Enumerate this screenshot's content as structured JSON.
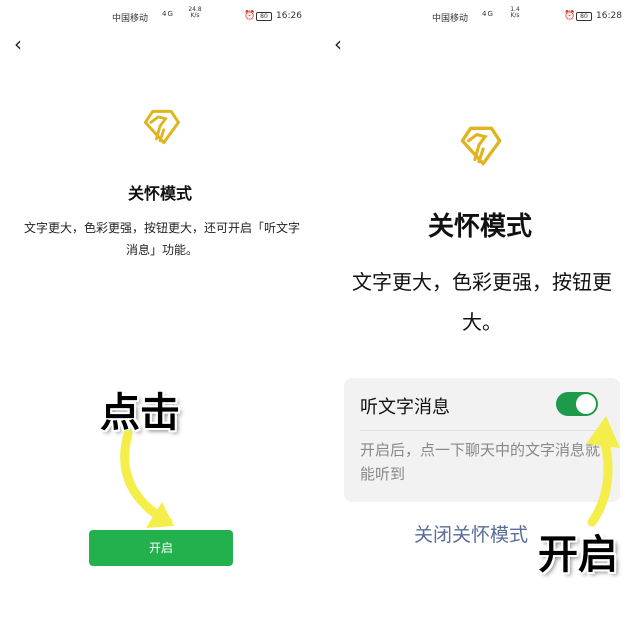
{
  "left": {
    "status": {
      "carrier": "中国移动",
      "network": "4G",
      "speed": "24.8 K/s",
      "battery": "80",
      "time": "16:26"
    },
    "back_icon": "‹",
    "title": "关怀模式",
    "description": "文字更大，色彩更强，按钮更大，还可开启「听文字消息」功能。",
    "callout": "点击",
    "open_button": "开启"
  },
  "right": {
    "status": {
      "carrier": "中国移动",
      "network": "4G",
      "speed": "1.4 K/s",
      "battery": "80",
      "time": "16:28"
    },
    "back_icon": "‹",
    "title": "关怀模式",
    "description": "文字更大，色彩更强，按钮更大。",
    "setting": {
      "label": "听文字消息",
      "enabled": true,
      "hint": "开启后，点一下聊天中的文字消息就能听到"
    },
    "close_link": "关闭关怀模式",
    "callout": "开启"
  },
  "colors": {
    "logo_gold": "#e0b41c",
    "button_green": "#22b14c",
    "toggle_green": "#1d9a4a",
    "callout_arrow": "#f3ee4a",
    "link_blue": "#5a6d96"
  },
  "icons": {
    "logo": "heart-hand-icon",
    "back": "back-arrow-icon",
    "wifi": "wifi-icon",
    "signal": "signal-icon",
    "alarm": "alarm-icon",
    "battery": "battery-icon"
  }
}
